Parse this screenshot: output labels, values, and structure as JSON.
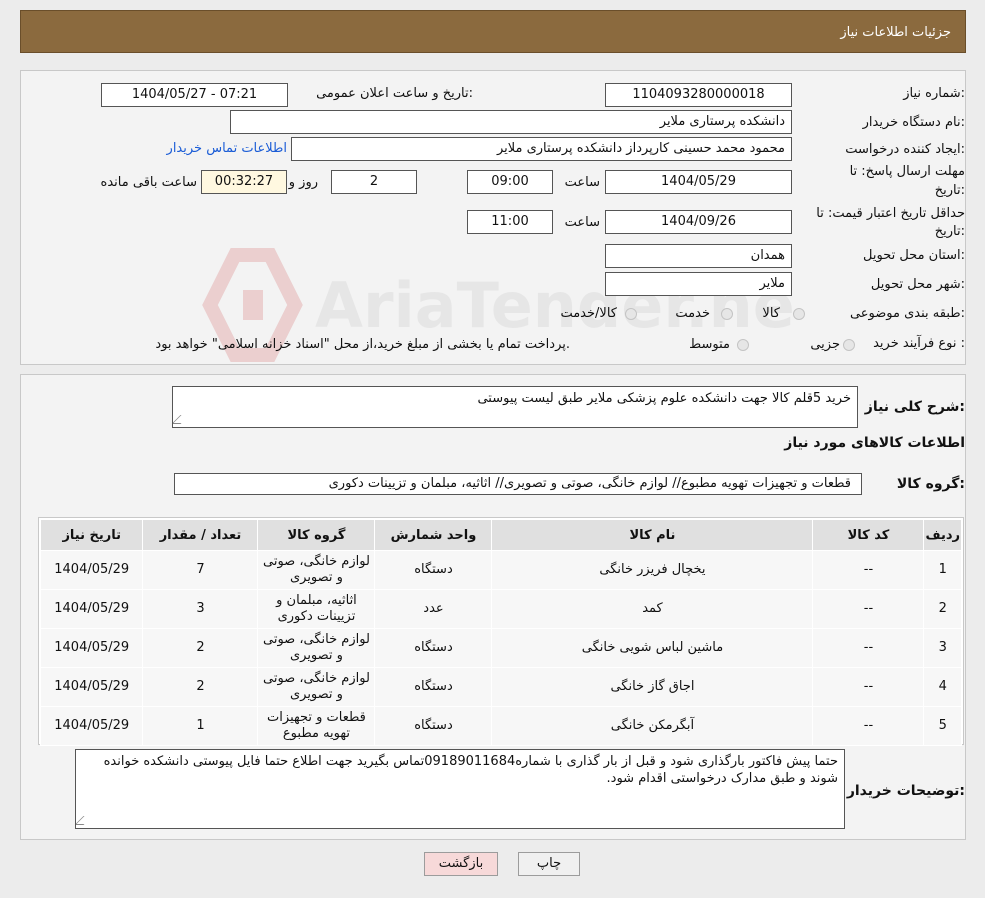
{
  "header": {
    "title": "جزئیات اطلاعات نیاز"
  },
  "form": {
    "need_number_label": "شماره نیاز:",
    "need_number": "1104093280000018",
    "announce_label": "تاریخ و ساعت اعلان عمومی:",
    "announce_value": "1404/05/27 - 07:21",
    "buyer_org_label": "نام دستگاه خریدار:",
    "buyer_org": "دانشکده پرستاری ملایر",
    "creator_label": "ایجاد کننده درخواست:",
    "creator": "محمود محمد حسینی کارپرداز دانشکده پرستاری ملایر",
    "contact_link": "اطلاعات تماس خریدار",
    "reply_deadline_label_1": "مهلت ارسال پاسخ: تا",
    "reply_deadline_label_2": "تاریخ:",
    "reply_date": "1404/05/29",
    "time_label": "ساعت",
    "reply_time": "09:00",
    "days_value": "2",
    "days_label": "روز و",
    "remaining_time": "00:32:27",
    "remaining_label": "ساعت باقی مانده",
    "validity_label_1": "حداقل تاریخ اعتبار قیمت: تا",
    "validity_label_2": "تاریخ:",
    "validity_date": "1404/09/26",
    "validity_time": "11:00",
    "province_label": "استان محل تحویل:",
    "province": "همدان",
    "city_label": "شهر محل تحویل:",
    "city": "ملایر",
    "category_label": "طبقه بندی موضوعی:",
    "category_options": [
      "کالا",
      "خدمت",
      "کالا/خدمت"
    ],
    "process_label": "نوع فرآیند خرید :",
    "process_options": [
      "جزیی",
      "متوسط"
    ],
    "process_note": "پرداخت تمام یا بخشی از مبلغ خرید،از محل \"اسناد خزانه اسلامی\" خواهد بود."
  },
  "details": {
    "summary_label": "شرح کلی نیاز:",
    "summary": "خرید 5قلم کالا جهت دانشکده علوم پزشکی ملایر طبق لیست پیوستی",
    "items_heading": "اطلاعات کالاهای مورد نیاز",
    "group_label": "گروه کالا:",
    "group_value": "قطعات و تجهیزات تهویه مطبوع// لوازم خانگی، صوتی و تصویری// اثاثیه، مبلمان و تزیینات دکوری",
    "table": {
      "headers": [
        "ردیف",
        "کد کالا",
        "نام کالا",
        "واحد شمارش",
        "گروه کالا",
        "تعداد / مقدار",
        "تاریخ نیاز"
      ],
      "rows": [
        [
          "1",
          "--",
          "یخچال فریزر خانگی",
          "دستگاه",
          "لوازم خانگی، صوتی و تصویری",
          "7",
          "1404/05/29"
        ],
        [
          "2",
          "--",
          "کمد",
          "عدد",
          "اثاثیه، مبلمان و تزیینات دکوری",
          "3",
          "1404/05/29"
        ],
        [
          "3",
          "--",
          "ماشین لباس شویی خانگی",
          "دستگاه",
          "لوازم خانگی، صوتی و تصویری",
          "2",
          "1404/05/29"
        ],
        [
          "4",
          "--",
          "اجاق گاز خانگی",
          "دستگاه",
          "لوازم خانگی، صوتی و تصویری",
          "2",
          "1404/05/29"
        ],
        [
          "5",
          "--",
          "آبگرمکن خانگی",
          "دستگاه",
          "قطعات و تجهیزات تهویه مطبوع",
          "1",
          "1404/05/29"
        ]
      ]
    },
    "buyer_notes_label": "توضیحات خریدار:",
    "buyer_notes": "حتما پیش فاکتور بارگذاری شود و قبل از بار گذاری با شماره09189011684تماس بگیرید جهت اطلاع حتما فایل پیوستی دانشکده خوانده شوند و طبق مدارک درخواستی اقدام شود."
  },
  "buttons": {
    "print": "چاپ",
    "back": "بازگشت"
  },
  "watermark": {
    "text": "AriaTender.neT"
  },
  "colors": {
    "header_bg": "#8b6a3e",
    "link": "#1a5cd6",
    "back_button_bg": "#f7d9d9"
  }
}
